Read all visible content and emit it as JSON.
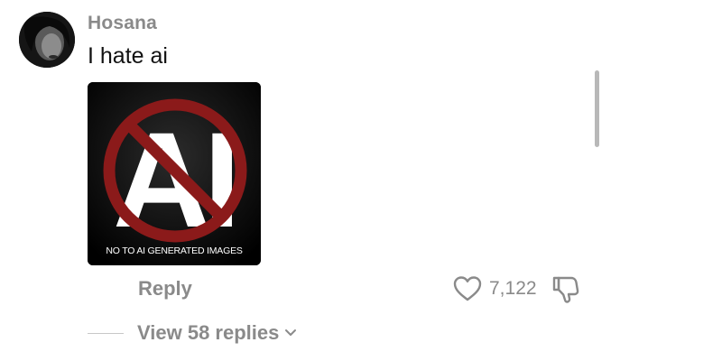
{
  "comment": {
    "username": "Hosana",
    "text": "I hate ai",
    "image": {
      "big_text": "AI",
      "caption": "NO TO AI GENERATED IMAGES",
      "prohibition_color": "#8b1a1a"
    },
    "avatar_icon": "user-avatar"
  },
  "actions": {
    "reply_label": "Reply",
    "like_count": "7,122",
    "like_icon": "heart-outline-icon",
    "dislike_icon": "thumbs-down-outline-icon"
  },
  "replies": {
    "view_label": "View 58 replies",
    "chevron_icon": "chevron-down-icon"
  },
  "colors": {
    "muted_text": "#8a8a8a",
    "primary_text": "#111111"
  }
}
